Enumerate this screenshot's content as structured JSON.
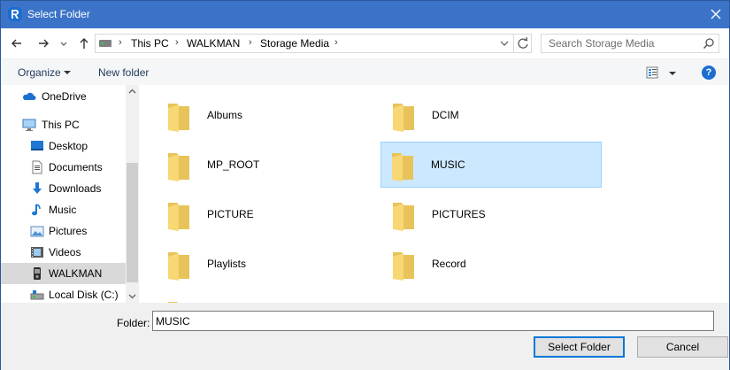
{
  "window": {
    "title": "Select Folder",
    "accent_color": "#3b73c8"
  },
  "address": {
    "drive_icon": "drive-icon",
    "breadcrumbs": [
      "This PC",
      "WALKMAN",
      "Storage Media"
    ],
    "search_placeholder": "Search Storage Media"
  },
  "toolbar": {
    "organize_label": "Organize",
    "new_folder_label": "New folder",
    "help_label": "?"
  },
  "navpane": {
    "items": [
      {
        "label": "OneDrive",
        "icon": "cloud-icon"
      },
      {
        "label": "This PC",
        "icon": "computer-icon"
      },
      {
        "label": "Desktop",
        "icon": "desktop-icon"
      },
      {
        "label": "Documents",
        "icon": "documents-icon"
      },
      {
        "label": "Downloads",
        "icon": "downloads-icon"
      },
      {
        "label": "Music",
        "icon": "music-icon"
      },
      {
        "label": "Pictures",
        "icon": "pictures-icon"
      },
      {
        "label": "Videos",
        "icon": "videos-icon"
      },
      {
        "label": "WALKMAN",
        "icon": "walkman-icon",
        "selected": true
      },
      {
        "label": "Local Disk (C:)",
        "icon": "local-disk-icon"
      }
    ]
  },
  "content": {
    "folders": [
      {
        "name": "Albums"
      },
      {
        "name": "DCIM"
      },
      {
        "name": "MP_ROOT"
      },
      {
        "name": "MUSIC",
        "selected": true
      },
      {
        "name": "PICTURE"
      },
      {
        "name": "PICTURES"
      },
      {
        "name": "Playlists"
      },
      {
        "name": "Record"
      }
    ]
  },
  "footer": {
    "folder_label": "Folder:",
    "folder_value": "MUSIC",
    "select_button": "Select Folder",
    "cancel_button": "Cancel"
  },
  "colors": {
    "selection_bg": "#cce8ff",
    "selection_border": "#99d1ff",
    "folder_yellow": "#f8d775"
  }
}
